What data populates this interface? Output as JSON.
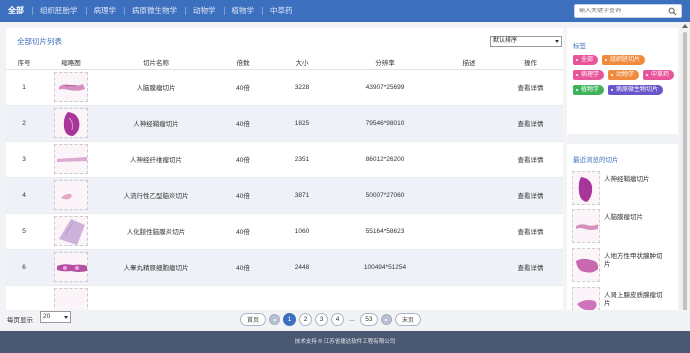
{
  "nav": {
    "items": [
      "全部",
      "组织胚胎学",
      "病理学",
      "病原微生物学",
      "动物学",
      "植物学",
      "中草药"
    ],
    "active_index": 0,
    "search_placeholder": "输入关键字查询"
  },
  "list": {
    "title": "全部切片列表",
    "sort_selected": "默认排序",
    "columns": [
      "序号",
      "缩略图",
      "切片名称",
      "倍数",
      "大小",
      "分辨率",
      "描述",
      "操作"
    ],
    "rows": [
      {
        "index": "1",
        "name": "人脑膜瘤切片",
        "magnification": "40倍",
        "size": "3228",
        "resolution": "43907*25699",
        "desc": "",
        "action": "查看详情",
        "thumb": "pink-strip"
      },
      {
        "index": "2",
        "name": "人神经鞘瘤切片",
        "magnification": "40倍",
        "size": "1825",
        "resolution": "79546*98010",
        "desc": "",
        "action": "查看详情",
        "thumb": "purple-blob"
      },
      {
        "index": "3",
        "name": "人神经纤维瘤切片",
        "magnification": "40倍",
        "size": "2351",
        "resolution": "86012*26200",
        "desc": "",
        "action": "查看详情",
        "thumb": "thin-strip"
      },
      {
        "index": "4",
        "name": "人流行性乙型脑炎切片",
        "magnification": "40倍",
        "size": "3871",
        "resolution": "50007*27060",
        "desc": "",
        "action": "查看详情",
        "thumb": "small-pink"
      },
      {
        "index": "5",
        "name": "人化脓性脑膜炎切片",
        "magnification": "40倍",
        "size": "1060",
        "resolution": "55164*58623",
        "desc": "",
        "action": "查看详情",
        "thumb": "lilac-block"
      },
      {
        "index": "6",
        "name": "人睾丸精原细胞瘤切片",
        "magnification": "40倍",
        "size": "2448",
        "resolution": "100494*51254",
        "desc": "",
        "action": "查看详情",
        "thumb": "dense-strip"
      }
    ]
  },
  "pager": {
    "per_page_label": "每页显示",
    "per_page_value": "20",
    "first_label": "首页",
    "last_label": "末页",
    "pages": [
      "1",
      "2",
      "3",
      "4"
    ],
    "current_page": "1",
    "ellipsis": "...",
    "total_pages": "53"
  },
  "side": {
    "tags_title": "标签",
    "tags": [
      {
        "label": "全部",
        "color": "#e8559a"
      },
      {
        "label": "组织胚切片",
        "color": "#f08a3c"
      },
      {
        "label": "病理学",
        "color": "#e8559a"
      },
      {
        "label": "动物学",
        "color": "#f08a3c"
      },
      {
        "label": "中草药",
        "color": "#e8559a"
      },
      {
        "label": "植物学",
        "color": "#3fb35a"
      },
      {
        "label": "病原微生物切片",
        "color": "#6a56c9"
      }
    ],
    "recent_title": "最近浏览的切片",
    "recent": [
      {
        "label": "人神经鞘瘤切片"
      },
      {
        "label": "人脑膜瘤切片"
      },
      {
        "label": "人地方性甲状腺肿切片"
      },
      {
        "label": "人肾上腺皮质腺瘤切片"
      }
    ]
  },
  "footer": {
    "text": "技术支持 ® 江苏省捷达软件工程有限公司"
  },
  "colors": {
    "brand": "#3d6fbf",
    "footer": "#4b5872"
  }
}
